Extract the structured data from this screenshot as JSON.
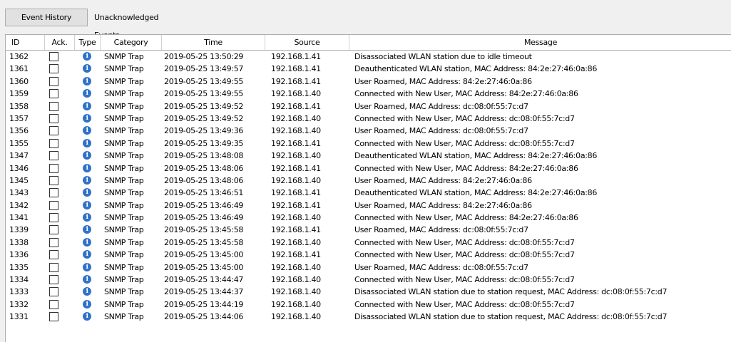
{
  "tabs": {
    "event_history": "Event History",
    "unacknowledged": "Unacknowledged Events"
  },
  "columns": {
    "id": "ID",
    "ack": "Ack.",
    "type": "Type",
    "category": "Category",
    "time": "Time",
    "source": "Source",
    "message": "Message"
  },
  "type_icon": "info-icon",
  "colors": {
    "info_icon": "#2f73c8",
    "header_border": "#adadad"
  },
  "rows": [
    {
      "id": "1362",
      "category": "SNMP Trap",
      "time": "2019-05-25 13:50:29",
      "source": "192.168.1.41",
      "message": "Disassociated WLAN station due to idle timeout"
    },
    {
      "id": "1361",
      "category": "SNMP Trap",
      "time": "2019-05-25 13:49:57",
      "source": "192.168.1.41",
      "message": "Deauthenticated WLAN station, MAC Address: 84:2e:27:46:0a:86"
    },
    {
      "id": "1360",
      "category": "SNMP Trap",
      "time": "2019-05-25 13:49:55",
      "source": "192.168.1.41",
      "message": "User Roamed, MAC Address: 84:2e:27:46:0a:86"
    },
    {
      "id": "1359",
      "category": "SNMP Trap",
      "time": "2019-05-25 13:49:55",
      "source": "192.168.1.40",
      "message": "Connected with New User, MAC Address: 84:2e:27:46:0a:86"
    },
    {
      "id": "1358",
      "category": "SNMP Trap",
      "time": "2019-05-25 13:49:52",
      "source": "192.168.1.41",
      "message": "User Roamed, MAC Address: dc:08:0f:55:7c:d7"
    },
    {
      "id": "1357",
      "category": "SNMP Trap",
      "time": "2019-05-25 13:49:52",
      "source": "192.168.1.40",
      "message": "Connected with New User, MAC Address: dc:08:0f:55:7c:d7"
    },
    {
      "id": "1356",
      "category": "SNMP Trap",
      "time": "2019-05-25 13:49:36",
      "source": "192.168.1.40",
      "message": "User Roamed, MAC Address: dc:08:0f:55:7c:d7"
    },
    {
      "id": "1355",
      "category": "SNMP Trap",
      "time": "2019-05-25 13:49:35",
      "source": "192.168.1.41",
      "message": "Connected with New User, MAC Address: dc:08:0f:55:7c:d7"
    },
    {
      "id": "1347",
      "category": "SNMP Trap",
      "time": "2019-05-25 13:48:08",
      "source": "192.168.1.40",
      "message": "Deauthenticated WLAN station, MAC Address: 84:2e:27:46:0a:86"
    },
    {
      "id": "1346",
      "category": "SNMP Trap",
      "time": "2019-05-25 13:48:06",
      "source": "192.168.1.41",
      "message": "Connected with New User, MAC Address: 84:2e:27:46:0a:86"
    },
    {
      "id": "1345",
      "category": "SNMP Trap",
      "time": "2019-05-25 13:48:06",
      "source": "192.168.1.40",
      "message": "User Roamed, MAC Address: 84:2e:27:46:0a:86"
    },
    {
      "id": "1343",
      "category": "SNMP Trap",
      "time": "2019-05-25 13:46:51",
      "source": "192.168.1.41",
      "message": "Deauthenticated WLAN station, MAC Address: 84:2e:27:46:0a:86"
    },
    {
      "id": "1342",
      "category": "SNMP Trap",
      "time": "2019-05-25 13:46:49",
      "source": "192.168.1.41",
      "message": "User Roamed, MAC Address: 84:2e:27:46:0a:86"
    },
    {
      "id": "1341",
      "category": "SNMP Trap",
      "time": "2019-05-25 13:46:49",
      "source": "192.168.1.40",
      "message": "Connected with New User, MAC Address: 84:2e:27:46:0a:86"
    },
    {
      "id": "1339",
      "category": "SNMP Trap",
      "time": "2019-05-25 13:45:58",
      "source": "192.168.1.41",
      "message": "User Roamed, MAC Address: dc:08:0f:55:7c:d7"
    },
    {
      "id": "1338",
      "category": "SNMP Trap",
      "time": "2019-05-25 13:45:58",
      "source": "192.168.1.40",
      "message": "Connected with New User, MAC Address: dc:08:0f:55:7c:d7"
    },
    {
      "id": "1336",
      "category": "SNMP Trap",
      "time": "2019-05-25 13:45:00",
      "source": "192.168.1.41",
      "message": "Connected with New User, MAC Address: dc:08:0f:55:7c:d7"
    },
    {
      "id": "1335",
      "category": "SNMP Trap",
      "time": "2019-05-25 13:45:00",
      "source": "192.168.1.40",
      "message": "User Roamed, MAC Address: dc:08:0f:55:7c:d7"
    },
    {
      "id": "1334",
      "category": "SNMP Trap",
      "time": "2019-05-25 13:44:47",
      "source": "192.168.1.40",
      "message": "Connected with New User, MAC Address: dc:08:0f:55:7c:d7"
    },
    {
      "id": "1333",
      "category": "SNMP Trap",
      "time": "2019-05-25 13:44:37",
      "source": "192.168.1.40",
      "message": "Disassociated WLAN station due to station request, MAC Address: dc:08:0f:55:7c:d7"
    },
    {
      "id": "1332",
      "category": "SNMP Trap",
      "time": "2019-05-25 13:44:19",
      "source": "192.168.1.40",
      "message": "Connected with New User, MAC Address: dc:08:0f:55:7c:d7"
    },
    {
      "id": "1331",
      "category": "SNMP Trap",
      "time": "2019-05-25 13:44:06",
      "source": "192.168.1.40",
      "message": "Disassociated WLAN station due to station request, MAC Address: dc:08:0f:55:7c:d7"
    }
  ]
}
